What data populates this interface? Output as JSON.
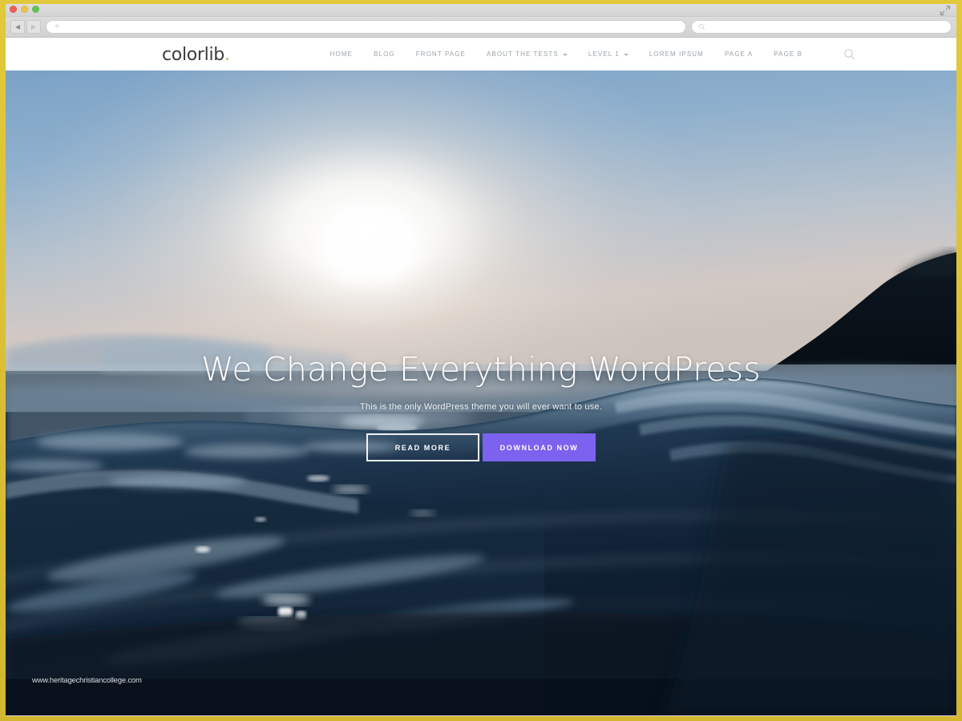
{
  "browser": {
    "traffic_lights": [
      "close",
      "minimize",
      "maximize"
    ],
    "back_label": "◀",
    "forward_label": "▶",
    "url_value": "",
    "url_placeholder": "+",
    "search_value": "",
    "search_placeholder": "",
    "expand_icon": "expand-arrows-icon"
  },
  "site": {
    "logo_text": "colorlib",
    "logo_accent": ".",
    "nav": [
      {
        "label": "HOME",
        "has_dropdown": false
      },
      {
        "label": "BLOG",
        "has_dropdown": false
      },
      {
        "label": "FRONT PAGE",
        "has_dropdown": false
      },
      {
        "label": "ABOUT THE TESTS",
        "has_dropdown": true
      },
      {
        "label": "LEVEL 1",
        "has_dropdown": true
      },
      {
        "label": "LOREM IPSUM",
        "has_dropdown": false
      },
      {
        "label": "PAGE A",
        "has_dropdown": false
      },
      {
        "label": "PAGE B",
        "has_dropdown": false
      }
    ],
    "search_icon": "search-icon"
  },
  "hero": {
    "title": "We Change Everything WordPress",
    "subtitle": "This is the only WordPress theme you will ever want to use.",
    "primary_button": "READ MORE",
    "secondary_button": "DOWNLOAD NOW",
    "watermark": "www.heritagechristiancollege.com",
    "image_description": "Ocean wave at sunset with a dark headland on the right"
  },
  "colors": {
    "frame_gold": "#d8c03a",
    "accent_purple": "#7b62ef",
    "logo_accent_green": "#8dc63f",
    "nav_text": "#9aa2a8",
    "hero_text": "#ffffff"
  }
}
